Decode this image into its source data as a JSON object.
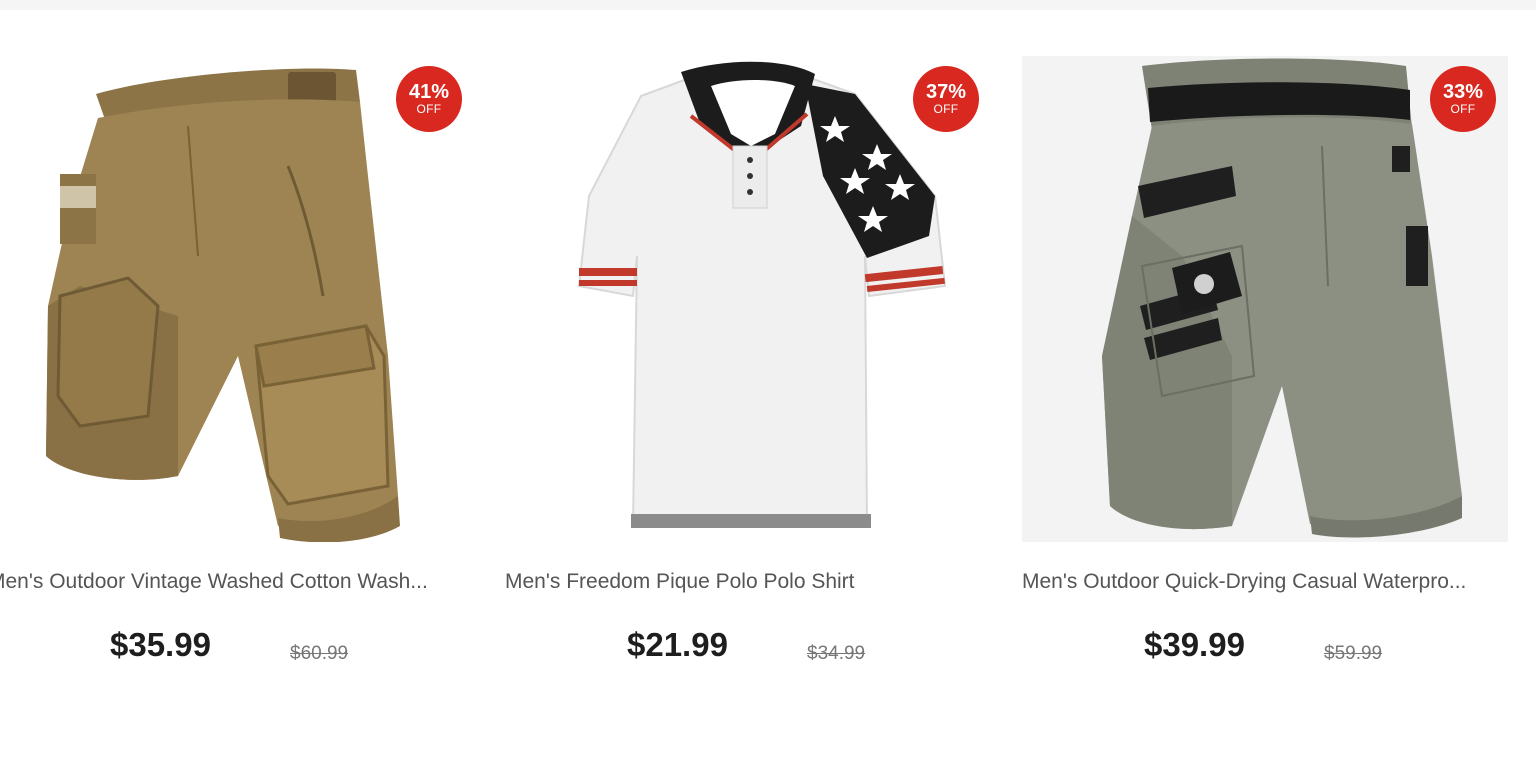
{
  "products": [
    {
      "title": "Men's Outdoor Vintage Washed Cotton Wash...",
      "price": "$35.99",
      "old_price": "$60.99",
      "discount": "41%",
      "discount_label": "OFF",
      "image_icon": "cargo-shorts-khaki"
    },
    {
      "title": "Men's Freedom Pique Polo Polo Shirt",
      "price": "$21.99",
      "old_price": "$34.99",
      "discount": "37%",
      "discount_label": "OFF",
      "image_icon": "polo-shirt-flag"
    },
    {
      "title": "Men's Outdoor Quick-Drying Casual Waterpro...",
      "price": "$39.99",
      "old_price": "$59.99",
      "discount": "33%",
      "discount_label": "OFF",
      "image_icon": "tactical-shorts-gray"
    }
  ],
  "colors": {
    "badge": "#d9281f",
    "price": "#1e1e1e",
    "title": "#555555",
    "old_price": "#777777"
  }
}
